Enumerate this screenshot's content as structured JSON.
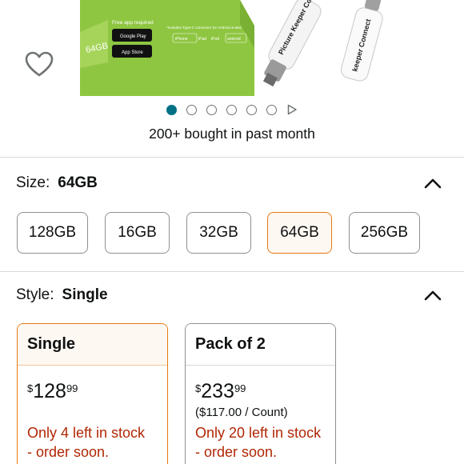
{
  "product_image": {
    "box_printed_text": {
      "line1": "Free app required",
      "badges": [
        "Google Play",
        "App Store"
      ],
      "capacity": "64GB",
      "includes": "*Includes Type-C connector for Android & Mac",
      "compat": [
        "iPhone",
        "iPad",
        "iPod",
        "android"
      ]
    },
    "device_text": [
      "Picture Keeper Connect",
      "keeper Connect"
    ]
  },
  "carousel": {
    "dot_count": 6,
    "active_index": 0,
    "has_video_play": true
  },
  "social_proof": {
    "bought_text": "200+ bought in past month"
  },
  "size_section": {
    "label": "Size:",
    "selected_value": "64GB",
    "options": [
      "128GB",
      "16GB",
      "32GB",
      "64GB",
      "256GB"
    ],
    "selected_index": 3
  },
  "style_section": {
    "label": "Style:",
    "selected_value": "Single",
    "options": [
      {
        "name": "Single",
        "price_currency": "$",
        "price_whole": "128",
        "price_fraction": "99",
        "unit_price": "",
        "stock_line1": "Only 4 left in stock",
        "stock_line2": "- order soon."
      },
      {
        "name": "Pack of 2",
        "price_currency": "$",
        "price_whole": "233",
        "price_fraction": "99",
        "unit_price": "($117.00 / Count)",
        "stock_line1": "Only 20 left in stock",
        "stock_line2": "- order soon."
      }
    ],
    "selected_index": 0
  },
  "colors": {
    "accent_selected_border": "#e47911",
    "selected_fill": "#fef8f2",
    "carousel_active": "#007185",
    "stock_warning": "#b12704",
    "divider": "#d5d9d9"
  }
}
